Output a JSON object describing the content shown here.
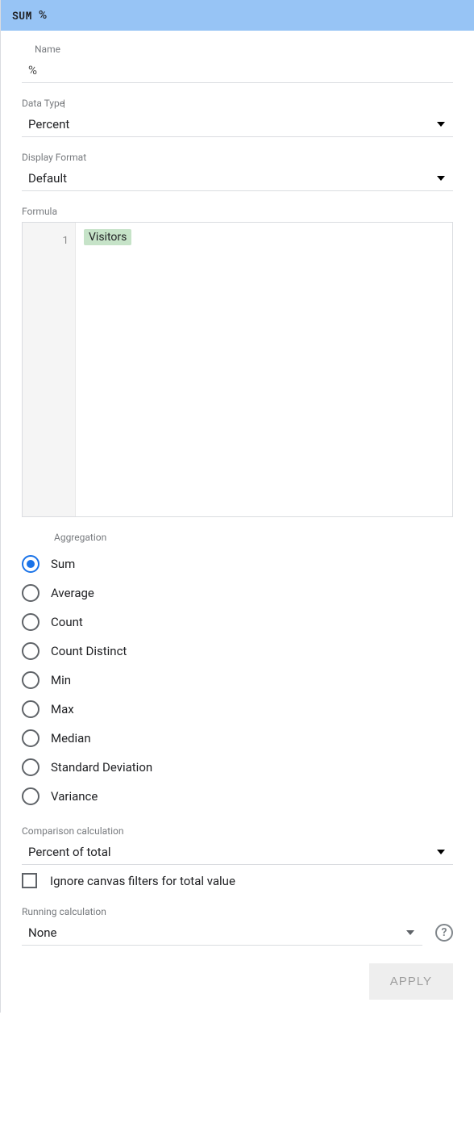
{
  "header": {
    "agg_badge": "SUM",
    "field_name": "%"
  },
  "name": {
    "label": "Name",
    "value": "%"
  },
  "data_type": {
    "label": "Data Type",
    "value": "Percent"
  },
  "display_format": {
    "label": "Display Format",
    "value": "Default"
  },
  "formula": {
    "label": "Formula",
    "line_number": "1",
    "token": "Visitors"
  },
  "aggregation": {
    "label": "Aggregation",
    "selected_index": 0,
    "options": [
      "Sum",
      "Average",
      "Count",
      "Count Distinct",
      "Min",
      "Max",
      "Median",
      "Standard Deviation",
      "Variance"
    ]
  },
  "comparison": {
    "label": "Comparison calculation",
    "value": "Percent of total",
    "ignore_filters_label": "Ignore canvas filters for total value",
    "ignore_filters_checked": false
  },
  "running": {
    "label": "Running calculation",
    "value": "None"
  },
  "buttons": {
    "apply": "APPLY"
  }
}
